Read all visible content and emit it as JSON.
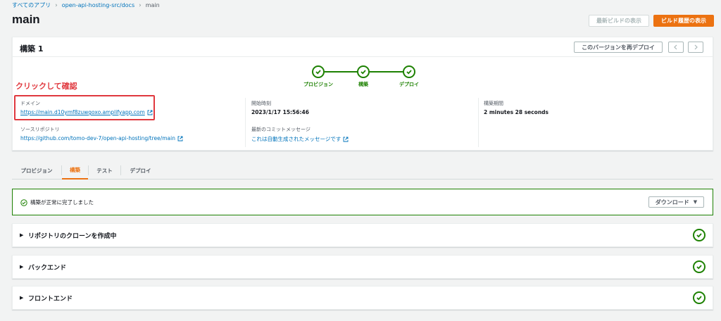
{
  "breadcrumb": {
    "items": [
      "すべてのアプリ",
      "open-api-hosting-src/docs",
      "main"
    ]
  },
  "page": {
    "title": "main",
    "view_latest_build_label": "最新ビルドの表示",
    "view_build_history_label": "ビルド履歴の表示"
  },
  "build": {
    "title": "構築 1",
    "redeploy_label": "このバージョンを再デプロイ",
    "steps": [
      {
        "label": "プロビジョン",
        "status": "success"
      },
      {
        "label": "構築",
        "status": "success"
      },
      {
        "label": "デプロイ",
        "status": "success"
      }
    ],
    "annotation": "クリックして確認",
    "domain_label": "ドメイン",
    "domain_value": "https://main.d10ymf8zuwgoxo.amplifyapp.com",
    "start_time_label": "開始時刻",
    "start_time_value": "2023/1/17 15:56:46",
    "duration_label": "構築期間",
    "duration_value": "2 minutes 28 seconds",
    "repo_label": "ソースリポジトリ",
    "repo_value": "https://github.com/tomo-dev-7/open-api-hosting/tree/main",
    "commit_label": "最新のコミットメッセージ",
    "commit_value": "これは自動生成されたメッセージです"
  },
  "tabs": [
    {
      "label": "プロビジョン",
      "active": false
    },
    {
      "label": "構築",
      "active": true
    },
    {
      "label": "テスト",
      "active": false
    },
    {
      "label": "デプロイ",
      "active": false
    }
  ],
  "status": {
    "message": "構築が正常に完了しました",
    "download_label": "ダウンロード"
  },
  "sections": [
    {
      "title": "リポジトリのクローンを作成中",
      "status": "success"
    },
    {
      "title": "バックエンド",
      "status": "success"
    },
    {
      "title": "フロントエンド",
      "status": "success"
    }
  ],
  "colors": {
    "success": "#1d8102",
    "primary": "#ec7211",
    "link": "#0073bb",
    "annotation": "#e0383e"
  }
}
